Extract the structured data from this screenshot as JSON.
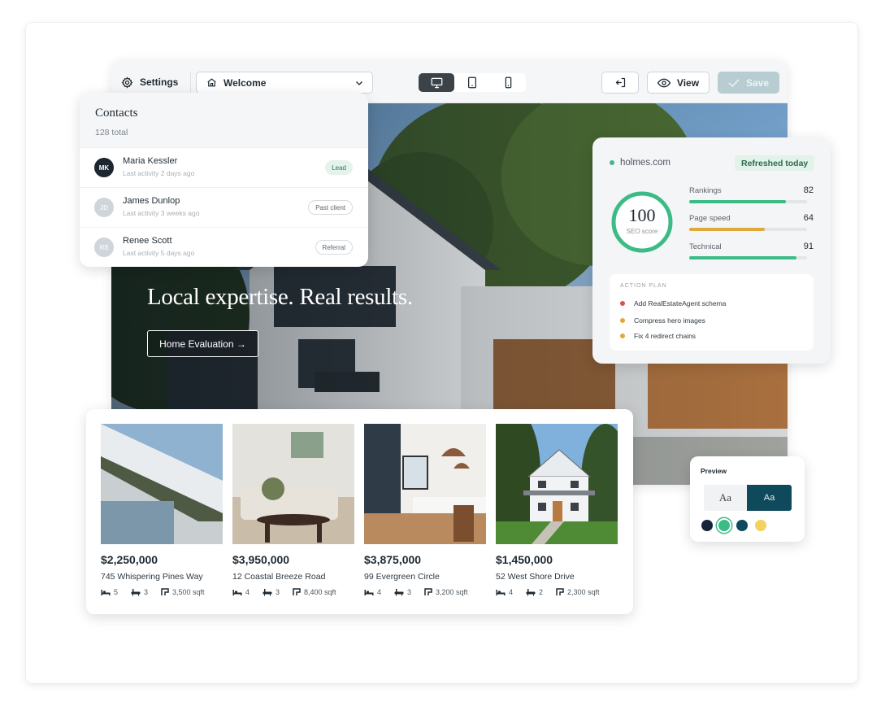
{
  "toolbar": {
    "settings_label": "Settings",
    "page_select_value": "Welcome",
    "view_label": "View",
    "save_label": "Save"
  },
  "hero": {
    "heading": "Local expertise. Real results.",
    "cta_label": "Home Evaluation →"
  },
  "contacts": {
    "title": "Contacts",
    "count": "128 total",
    "items": [
      {
        "initials": "MK",
        "name": "Maria Kessler",
        "meta": "Last activity 2 days ago",
        "badge": "Lead"
      },
      {
        "initials": "JD",
        "name": "James Dunlop",
        "meta": "Last activity 3 weeks ago",
        "badge": "Past client"
      },
      {
        "initials": "RS",
        "name": "Renee Scott",
        "meta": "Last activity 5 days ago",
        "badge": "Referral"
      }
    ]
  },
  "seo": {
    "domain": "holmes.com",
    "refreshed": "Refreshed today",
    "score": "100",
    "score_label": "SEO score",
    "metrics": [
      {
        "name": "Rankings",
        "value": "82",
        "color": "#3dbb86"
      },
      {
        "name": "Page speed",
        "value": "64",
        "color": "#e0a93b"
      },
      {
        "name": "Technical",
        "value": "91",
        "color": "#3dbb86"
      }
    ],
    "plan_title": "ACTION PLAN",
    "plan": [
      {
        "text": "Add RealEstateAgent schema",
        "color": "#d9534f"
      },
      {
        "text": "Compress hero images",
        "color": "#e0a93b"
      },
      {
        "text": "Fix 4 redirect chains",
        "color": "#e0a93b"
      }
    ]
  },
  "listings": [
    {
      "price": "$2,250,000",
      "address": "745 Whispering Pines Way",
      "beds": "5",
      "baths": "3",
      "sqft": "3,500 sqft"
    },
    {
      "price": "$3,950,000",
      "address": "12 Coastal Breeze Road",
      "beds": "4",
      "baths": "3",
      "sqft": "8,400 sqft"
    },
    {
      "price": "$3,875,000",
      "address": "99 Evergreen Circle",
      "beds": "4",
      "baths": "3",
      "sqft": "3,200 sqft"
    },
    {
      "price": "$1,450,000",
      "address": "52 West Shore Drive",
      "beds": "4",
      "baths": "2",
      "sqft": "2,300 sqft"
    }
  ],
  "preview": {
    "title": "Preview",
    "type_a": "Aa",
    "type_b": "Aa",
    "swatches": [
      "#16243a",
      "#3dbb86",
      "#0e4a5c",
      "#f2d15e"
    ]
  }
}
